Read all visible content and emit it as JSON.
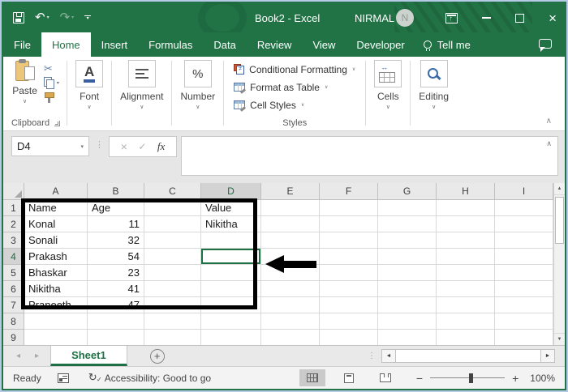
{
  "titlebar": {
    "title": "Book2 - Excel",
    "user": "NIRMAL",
    "avatar": "N"
  },
  "tabs": {
    "items": [
      {
        "label": "File"
      },
      {
        "label": "Home"
      },
      {
        "label": "Insert"
      },
      {
        "label": "Formulas"
      },
      {
        "label": "Data"
      },
      {
        "label": "Review"
      },
      {
        "label": "View"
      },
      {
        "label": "Developer"
      }
    ],
    "tell_me": "Tell me"
  },
  "ribbon": {
    "paste": "Paste",
    "clipboard": "Clipboard",
    "font": "Font",
    "alignment": "Alignment",
    "number": "Number",
    "styles_items": [
      "Conditional Formatting",
      "Format as Table",
      "Cell Styles"
    ],
    "styles": "Styles",
    "cells": "Cells",
    "editing": "Editing"
  },
  "formula": {
    "name_box": "D4"
  },
  "grid": {
    "columns": [
      "A",
      "B",
      "C",
      "D",
      "E",
      "F",
      "G",
      "H",
      "I"
    ],
    "selected_column": "D",
    "selected_row": 4,
    "selected_cell": "D4",
    "rows": [
      {
        "n": 1,
        "cells": [
          "Name",
          "Age",
          "",
          "Value",
          "",
          "",
          "",
          "",
          ""
        ]
      },
      {
        "n": 2,
        "cells": [
          "Konal",
          "11",
          "",
          "Nikitha",
          "",
          "",
          "",
          "",
          ""
        ]
      },
      {
        "n": 3,
        "cells": [
          "Sonali",
          "32",
          "",
          "",
          "",
          "",
          "",
          "",
          ""
        ]
      },
      {
        "n": 4,
        "cells": [
          "Prakash",
          "54",
          "",
          "",
          "",
          "",
          "",
          "",
          ""
        ]
      },
      {
        "n": 5,
        "cells": [
          "Bhaskar",
          "23",
          "",
          "",
          "",
          "",
          "",
          "",
          ""
        ]
      },
      {
        "n": 6,
        "cells": [
          "Nikitha",
          "41",
          "",
          "",
          "",
          "",
          "",
          "",
          ""
        ]
      },
      {
        "n": 7,
        "cells": [
          "Praneeth",
          "47",
          "",
          "",
          "",
          "",
          "",
          "",
          ""
        ]
      },
      {
        "n": 8,
        "cells": [
          "",
          "",
          "",
          "",
          "",
          "",
          "",
          "",
          ""
        ]
      },
      {
        "n": 9,
        "cells": [
          "",
          "",
          "",
          "",
          "",
          "",
          "",
          "",
          ""
        ]
      }
    ]
  },
  "sheetbar": {
    "sheet": "Sheet1"
  },
  "statusbar": {
    "mode": "Ready",
    "accessibility": "Accessibility: Good to go",
    "zoom": "100%"
  },
  "icons": {
    "undo": "↶",
    "redo": "↷",
    "dropdown": "▾",
    "chevron_down": "∨",
    "chevron_up": "∧",
    "close": "×",
    "scissors": "✂",
    "cancel": "×",
    "enter": "✓",
    "fx": "fx",
    "dots": "⋮",
    "up": "▲",
    "down": "▼",
    "left": "◄",
    "right": "►",
    "nav_left": "◂",
    "nav_right": "▸",
    "plus": "+",
    "percent": "%",
    "font_letter": "A",
    "refresh": "↻",
    "check": "✓"
  }
}
